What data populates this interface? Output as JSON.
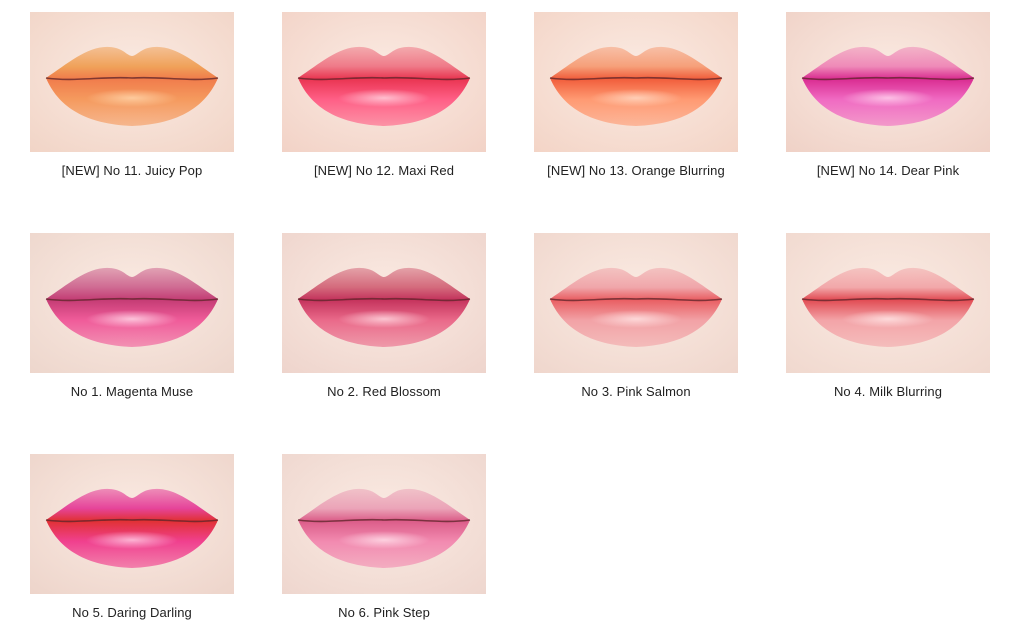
{
  "swatches": [
    {
      "label": "[NEW] No 11. Juicy Pop",
      "skin": "#f1d4c6",
      "top": "#f0a25a",
      "mid": "#f07a4a",
      "bottom": "#f59a5e",
      "shine": "#ffd3a8"
    },
    {
      "label": "[NEW] No 12. Maxi Red",
      "skin": "#f2d2c6",
      "top": "#ef7a88",
      "mid": "#e8324e",
      "bottom": "#ff5f86",
      "shine": "#ffd0dc"
    },
    {
      "label": "[NEW] No 13. Orange Blurring",
      "skin": "#f3d4c6",
      "top": "#f6a07a",
      "mid": "#f05a38",
      "bottom": "#ff9a72",
      "shine": "#ffd8c2"
    },
    {
      "label": "[NEW] No 14. Dear Pink",
      "skin": "#efd1c6",
      "top": "#ef8ab8",
      "mid": "#d8288e",
      "bottom": "#f06ac2",
      "shine": "#ffd0ec"
    },
    {
      "label": "No 1. Magenta Muse",
      "skin": "#edd6cc",
      "top": "#cf6a92",
      "mid": "#c23a72",
      "bottom": "#f05c9a",
      "shine": "#ffd6e6"
    },
    {
      "label": "No 2. Red Blossom",
      "skin": "#eed4cc",
      "top": "#d46a7c",
      "mid": "#c2305a",
      "bottom": "#ea6a8a",
      "shine": "#ffd6de"
    },
    {
      "label": "No 3. Pink Salmon",
      "skin": "#efd6cc",
      "top": "#f0a6aa",
      "mid": "#e85a5e",
      "bottom": "#f2a2a6",
      "shine": "#ffe2e2"
    },
    {
      "label": "No 4. Milk Blurring",
      "skin": "#f0d8ce",
      "top": "#f2a8aa",
      "mid": "#e0464e",
      "bottom": "#f3a4a8",
      "shine": "#ffe4e4"
    },
    {
      "label": "No 5. Daring Darling",
      "skin": "#edd4ca",
      "top": "#e6449a",
      "mid": "#e0302e",
      "bottom": "#f0408e",
      "shine": "#ffc8e0"
    },
    {
      "label": "No 6. Pink Step",
      "skin": "#eed6ce",
      "top": "#eba4b8",
      "mid": "#da5a86",
      "bottom": "#f28ab0",
      "shine": "#ffdde8"
    }
  ]
}
